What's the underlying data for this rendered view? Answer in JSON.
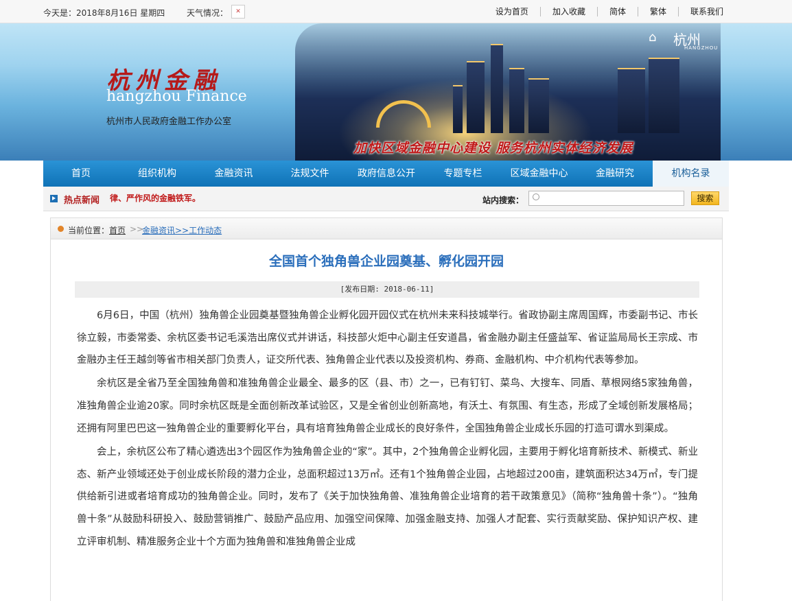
{
  "topbar": {
    "date": "今天是：2018年8月16日 星期四",
    "weather_label": "天气情况：",
    "links": [
      "设为首页",
      "加入收藏",
      "简体",
      "繁体",
      "联系我们"
    ]
  },
  "banner": {
    "logo_cn": "杭州金融",
    "logo_en": "hangzhou Finance",
    "logo_sub": "杭州市人民政府金融工作办公室",
    "slogan": "加快区域金融中心建设  服务杭州实体经济发展",
    "city_logo": "杭州",
    "city_logo_en": "HANGZHOU"
  },
  "nav": {
    "items": [
      "首页",
      "组织机构",
      "金融资讯",
      "法规文件",
      "政府信息公开",
      "专题专栏",
      "区域金融中心",
      "金融研究",
      "机构名录"
    ],
    "active_index": 8
  },
  "hotbar": {
    "label": "热点新闻",
    "marquee": "律、严作风的金融铁军。",
    "search_label": "站内搜索：",
    "search_placeholder": "",
    "search_button": "搜索"
  },
  "crumb": {
    "prefix": "当前位置：",
    "home": "首页",
    "sep": ">>",
    "path": "金融资讯>>工作动态"
  },
  "article": {
    "title": "全国首个独角兽企业园奠基、孵化园开园",
    "date": "[发布日期:  2018-06-11]",
    "paragraphs": [
      "6月6日，中国（杭州）独角兽企业园奠基暨独角兽企业孵化园开园仪式在杭州未来科技城举行。省政协副主席周国辉，市委副书记、市长徐立毅，市委常委、余杭区委书记毛溪浩出席仪式并讲话，科技部火炬中心副主任安道昌，省金融办副主任盛益军、省证监局局长王宗成、市金融办主任王越剑等省市相关部门负责人，证交所代表、独角兽企业代表以及投资机构、券商、金融机构、中介机构代表等参加。",
      "余杭区是全省乃至全国独角兽和准独角兽企业最全、最多的区（县、市）之一，已有钉钉、菜鸟、大搜车、同盾、草根网络5家独角兽，准独角兽企业逾20家。同时余杭区既是全面创新改革试验区，又是全省创业创新高地，有沃土、有氛围、有生态，形成了全域创新发展格局；还拥有阿里巴巴这一独角兽企业的重要孵化平台，具有培育独角兽企业成长的良好条件，全国独角兽企业成长乐园的打造可谓水到渠成。",
      "会上，余杭区公布了精心遴选出3个园区作为独角兽企业的“家”。其中，2个独角兽企业孵化园，主要用于孵化培育新技术、新模式、新业态、新产业领域还处于创业成长阶段的潜力企业，总面积超过13万㎡。还有1个独角兽企业园，占地超过200亩，建筑面积达34万㎡，专门提供给新引进或者培育成功的独角兽企业。同时，发布了《关于加快独角兽、准独角兽企业培育的若干政策意见》（简称“独角兽十条”）。“独角兽十条”从鼓励科研投入、鼓励营销推广、鼓励产品应用、加强空间保障、加强金融支持、加强人才配套、实行贡献奖励、保护知识产权、建立评审机制、精准服务企业十个方面为独角兽和准独角兽企业成"
    ]
  }
}
